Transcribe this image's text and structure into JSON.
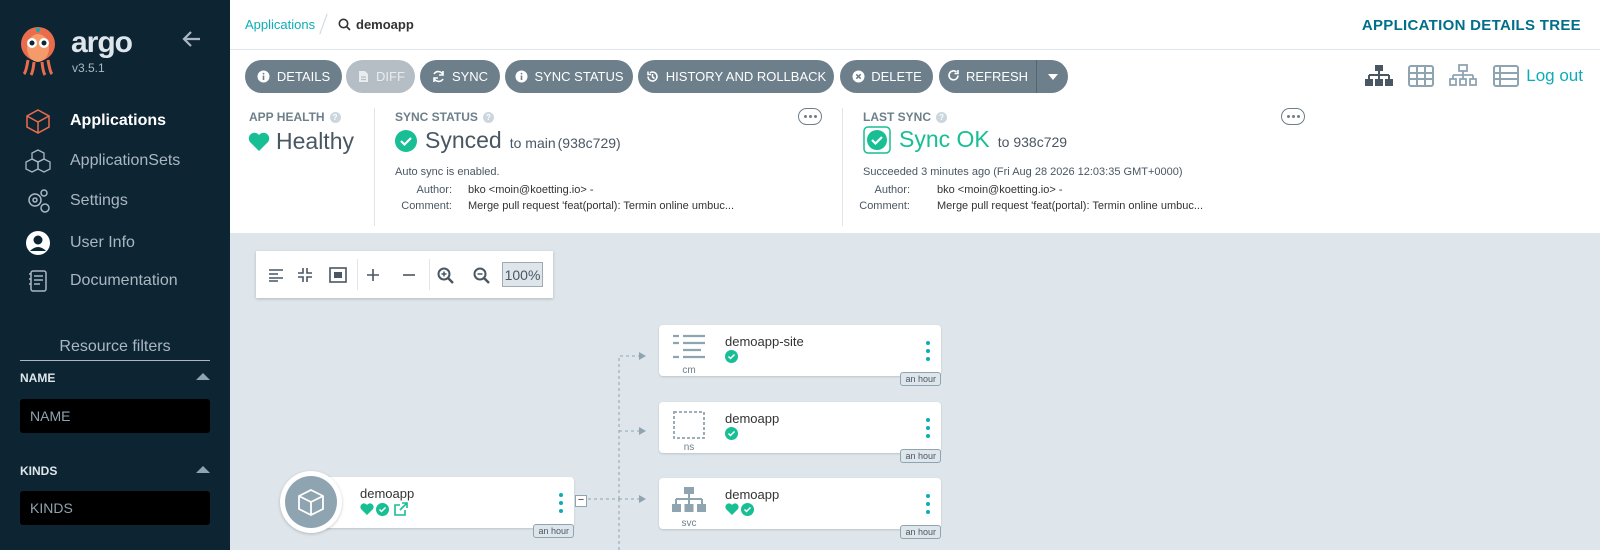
{
  "sidebar": {
    "brand": "argo",
    "version": "v3.5.1",
    "nav": [
      {
        "label": "Applications"
      },
      {
        "label": "ApplicationSets"
      },
      {
        "label": "Settings"
      },
      {
        "label": "User Info"
      },
      {
        "label": "Documentation"
      }
    ],
    "resource_filters_title": "Resource filters",
    "filters": [
      {
        "label": "NAME",
        "placeholder": "NAME"
      },
      {
        "label": "KINDS",
        "placeholder": "KINDS"
      }
    ]
  },
  "topbar": {
    "breadcrumb_link": "Applications",
    "search_value": "demoapp",
    "title": "APPLICATION DETAILS TREE"
  },
  "toolbar": {
    "details": "DETAILS",
    "diff": "DIFF",
    "sync": "SYNC",
    "sync_status": "SYNC STATUS",
    "history": "HISTORY AND ROLLBACK",
    "delete": "DELETE",
    "refresh": "REFRESH",
    "logout": "Log out"
  },
  "status": {
    "app_health": {
      "label": "APP HEALTH",
      "value": "Healthy"
    },
    "sync_status": {
      "label": "SYNC STATUS",
      "value": "Synced",
      "to_text": "to main",
      "revision": "(938c729)",
      "auto_sync": "Auto sync is enabled.",
      "author_key": "Author:",
      "author": "bko <moin@koetting.io> -",
      "comment_key": "Comment:",
      "comment": "Merge pull request 'feat(portal): Termin online umbuc..."
    },
    "last_sync": {
      "label": "LAST SYNC",
      "value": "Sync OK",
      "to_text": "to 938c729",
      "succeeded": "Succeeded 3 minutes ago (Fri Aug 28 2026 12:03:35 GMT+0000)",
      "author_key": "Author:",
      "author": "bko <moin@koetting.io> -",
      "comment_key": "Comment:",
      "comment": "Merge pull request 'feat(portal): Termin online umbuc..."
    }
  },
  "canvas": {
    "zoom_level": "100%",
    "app_node": {
      "name": "demoapp",
      "age": "an hour"
    },
    "nodes": [
      {
        "name": "demoapp-site",
        "kind": "cm",
        "age": "an hour"
      },
      {
        "name": "demoapp",
        "kind": "ns",
        "age": "an hour"
      },
      {
        "name": "demoapp",
        "kind": "svc",
        "age": "an hour"
      }
    ],
    "collapse_glyph": "−"
  },
  "colors": {
    "sidebar_bg": "#0d2533",
    "accent": "#0dadb5",
    "healthy": "#18be94",
    "button": "#6d7f8b",
    "title": "#006f8a"
  }
}
